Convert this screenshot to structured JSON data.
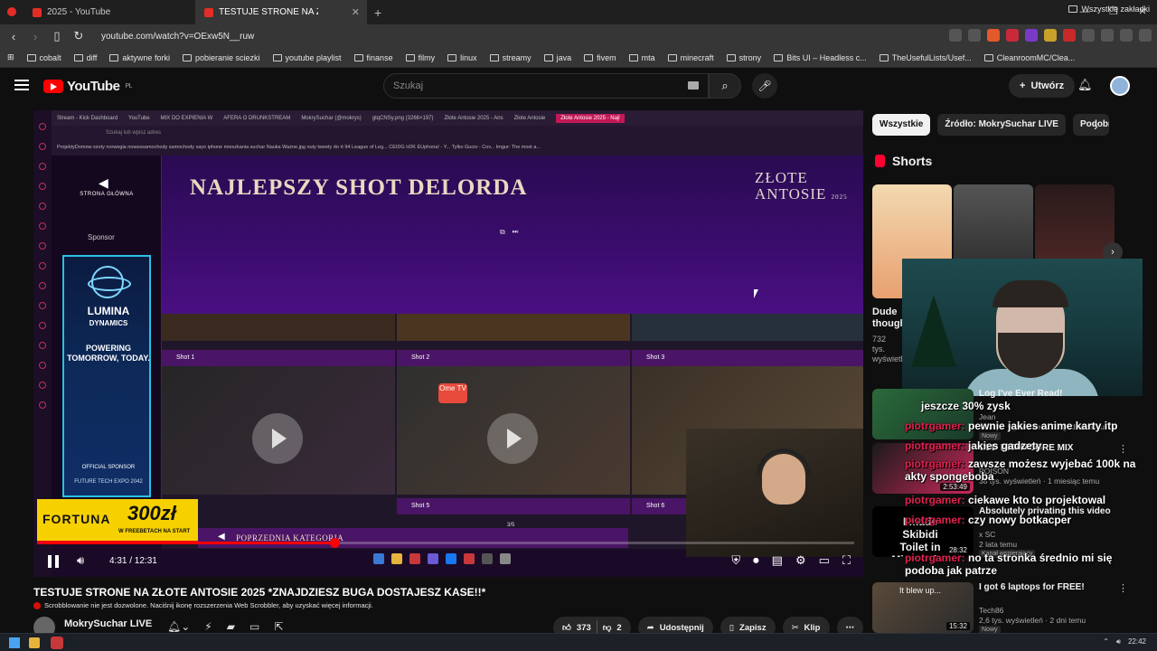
{
  "browser": {
    "tabs": [
      {
        "label": "2025 - YouTube"
      },
      {
        "label": "TESTUJE STRONE NA ZŁOTE ANTOSIE"
      }
    ],
    "url": "youtube.com/watch?v=OExw5N__ruw",
    "bookmarks": [
      "cobalt",
      "diff",
      "aktywne forki",
      "pobieranie sciezki",
      "youtube playlist",
      "finanse",
      "filmy",
      "linux",
      "streamy",
      "java",
      "fivem",
      "mta",
      "minecraft",
      "strony",
      "Bits UI – Headless c...",
      "TheUsefulLists/Usef...",
      "CleanroomMC/Clea..."
    ],
    "bookmarks_right": "Wszystkie zakładki"
  },
  "youtube": {
    "logo": "YouTube",
    "logo_country": "PL",
    "search_placeholder": "Szukaj",
    "create_label": "Utwórz"
  },
  "player": {
    "inner_tabs": [
      "Stream - Kick Dashboard",
      "YouTube",
      "MIX DO EXPIENIA W",
      "AFERA O DRUNKSTREAM",
      "MokrySuchar (@mokrys)",
      "gtqCNSy.png (3266×197)",
      "Złote Antosie 2025 - Ans",
      "Złote Antosie",
      "Złote Antosie 2025 - Najl"
    ],
    "inner_addr": "Szukaj lub wpisz adres",
    "inner_bookmarks": "ProjektyDomow   szoty   norwegia   nowessamochody   samochody xayo   iphone   mieszkania suchar   Nauka   Ważne.jpg   nuty   tweety do rt   94 League of Leg...   CEIDG   H2K EUphoria! - Y...   Tylko Gucio - Cov...   Imgur: The most a...",
    "back_label": "STRONA GŁÓWNA",
    "sponsor_label": "Sponsor",
    "ad": {
      "brand_line1": "LUMINA",
      "brand_line2": "DYNAMICS",
      "tagline": "POWERING TOMORROW, TODAY.",
      "official": "OFFICIAL SPONSOR",
      "expo": "FUTURE TECH EXPO 2042"
    },
    "title": "NAJLEPSZY SHOT DELORDA",
    "event_logo_line1": "ZŁOTE",
    "event_logo_line2": "ANTOSIE",
    "event_year": "2025",
    "shots": [
      "Shot 1",
      "Shot 2",
      "Shot 3",
      "Shot 5",
      "Shot 6"
    ],
    "ome_label": "Ome TV",
    "fortuna": {
      "brand": "FORTUNA",
      "amount": "300zł",
      "sub": "W FREEBETACH NA START"
    },
    "prev_category": "POPRZEDNIA KATEGORIA",
    "counter": "3/5",
    "time": "4:31 / 12:31",
    "progress_fraction": 0.36
  },
  "sidebar": {
    "chips": [
      "Wszystkie",
      "Źródło: MokrySuchar LIVE",
      "Podobn"
    ],
    "shorts_title": "Shorts",
    "short_title": "Dude though",
    "short_meta": "732 tys. wyświetl",
    "recs": [
      {
        "title": "Log I've Ever Read!",
        "channel": "Jean",
        "meta": "480 tys. wyświetleń · 21 godzin temu",
        "badge": "Nowy",
        "duration": ""
      },
      {
        "title": "OLD NIGHTCORE MIX",
        "channel": "POISON",
        "meta": "38 tys. wyświetleń · 1 miesiąc temu",
        "badge": "",
        "duration": "2:53:49"
      },
      {
        "title": "Absolutely privating this video",
        "channel": "x SC",
        "meta": "2 lata temu",
        "badge": "Kanał wspierający",
        "duration": "28:32"
      },
      {
        "title": "I got 6 laptops for FREE!",
        "channel": "Tech86",
        "meta": "2,6 tys. wyświetleń · 2 dni temu",
        "badge": "Nowy",
        "duration": "15:32"
      }
    ],
    "rec_thumb_texts": [
      "I made Skibidi Toilet in Minecraft...",
      "It blew up..."
    ]
  },
  "chat": [
    {
      "user": "",
      "text": "jeszcze 30% zysk"
    },
    {
      "user": "piotrgamer:",
      "text": "pewnie jakies anime karty itp"
    },
    {
      "user": "piotrgamer:",
      "text": "jakies gadzety"
    },
    {
      "user": "piotrgamer:",
      "text": "zawsze możesz wyjebać 100k na akty spongeboba"
    },
    {
      "user": "piotrgamer:",
      "text": "ciekawe kto to projektowal"
    },
    {
      "user": "piotrgamer:",
      "text": "czy nowy botkacper"
    },
    {
      "user": "piotrgamer:",
      "text": "no ta stronka średnio mi się podoba jak patrze"
    }
  ],
  "video": {
    "title": "TESTUJE STRONE NA ZŁOTE ANTOSIE 2025 *ZNAJDZIESZ BUGA DOSTAJESZ KASE!!*",
    "scrobble": "Scrobblowanie nie jest dozwolone. Naciśnij ikonę rozszerzenia Web Scrobbler, aby uzyskać więcej informacji.",
    "channel": "MokrySuchar LIVE",
    "likes": "373",
    "dislikes": "2",
    "share": "Udostępnij",
    "save": "Zapisz",
    "clip": "Klip"
  },
  "os": {
    "clock": "22:42"
  }
}
